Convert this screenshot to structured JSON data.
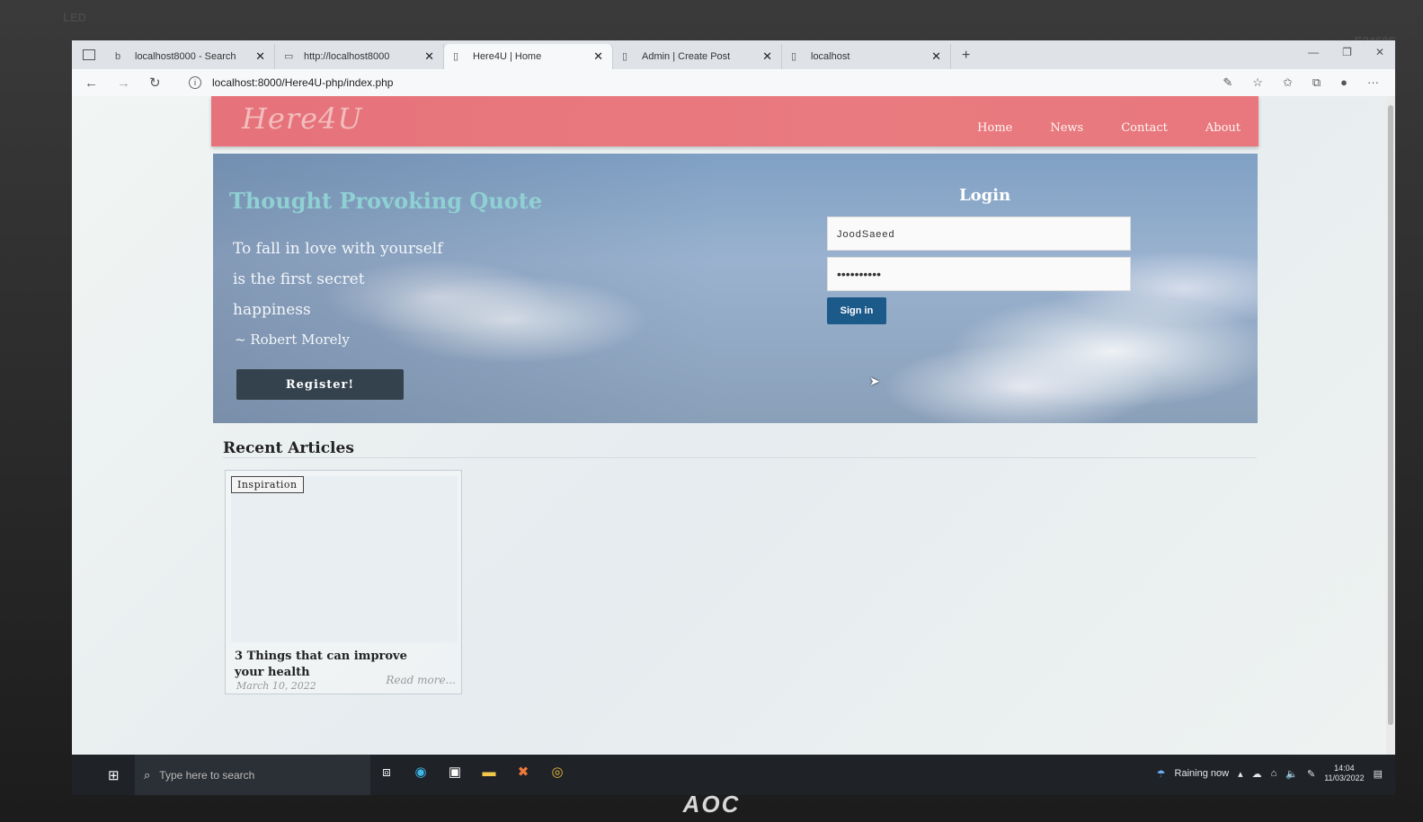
{
  "monitor": {
    "brand_top_left": "LED",
    "brand_top_right": "E2460S",
    "logo": "AOC"
  },
  "browser": {
    "tabs": [
      {
        "title": "localhost8000 - Search",
        "icon": "search-icon",
        "active": false
      },
      {
        "title": "http://localhost8000",
        "icon": "page-icon",
        "active": false
      },
      {
        "title": "Here4U | Home",
        "icon": "page-icon",
        "active": true
      },
      {
        "title": "Admin | Create Post",
        "icon": "page-icon",
        "active": false
      },
      {
        "title": "localhost",
        "icon": "page-icon",
        "active": false
      }
    ],
    "url": "localhost:8000/Here4U-php/index.php"
  },
  "site": {
    "logo": "Here4U",
    "nav": [
      "Home",
      "News",
      "Contact",
      "About"
    ],
    "hero": {
      "quote_title": "Thought Provoking Quote",
      "quote_lines": [
        "To fall in love with yourself",
        "is the first secret",
        "happiness"
      ],
      "author": "~ Robert Morely",
      "register_label": "Register!"
    },
    "login": {
      "title": "Login",
      "username_value": "JoodSaeed",
      "password_value": "••••••••••",
      "signin_label": "Sign in"
    },
    "recent": {
      "title": "Recent Articles",
      "articles": [
        {
          "tag": "Inspiration",
          "title": "3 Things that can improve your health",
          "date": "March 10, 2022",
          "more": "Read more..."
        }
      ]
    }
  },
  "taskbar": {
    "search_placeholder": "Type here to search",
    "weather": "Raining now",
    "time": "14:04",
    "date": "11/03/2022"
  },
  "colors": {
    "header": "#e6727b",
    "register_button": "#34424d",
    "signin_button": "#1c5a8a",
    "quote_title": "#8fd1d3"
  }
}
